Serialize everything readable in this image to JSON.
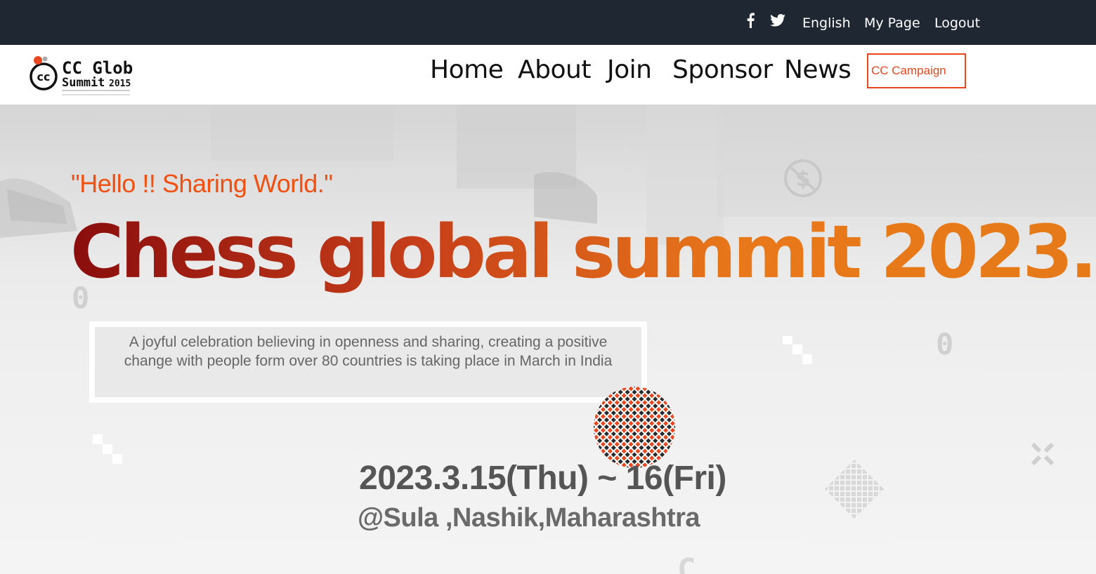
{
  "topbar": {
    "social": [
      "facebook-icon",
      "twitter-icon"
    ],
    "links": {
      "language": "English",
      "my_page": "My Page",
      "logout": "Logout"
    }
  },
  "logo": {
    "line1": "CC Global",
    "line2": "Summit",
    "year": "2015"
  },
  "nav": {
    "items": [
      "Home",
      "About",
      "Join",
      "Sponsor",
      "News"
    ],
    "campaign": "CC Campaign"
  },
  "hero": {
    "quote": "\"Hello !! Sharing World.\"",
    "headline": "Chess global summit 2023.",
    "description_line1": "A joyful celebration believing in openness and sharing, creating a positive",
    "description_line2": "change with people form over 80 countries is taking place in March in India",
    "date": "2023.3.15(Thu) ~ 16(Fri)",
    "venue": "@Sula ,Nashik,Maharashtra"
  },
  "colors": {
    "topbar_bg": "#1f2832",
    "accent": "#e8471f",
    "quote": "#f05010",
    "headline_start": "#8a0d0d",
    "headline_end": "#e67a18"
  }
}
